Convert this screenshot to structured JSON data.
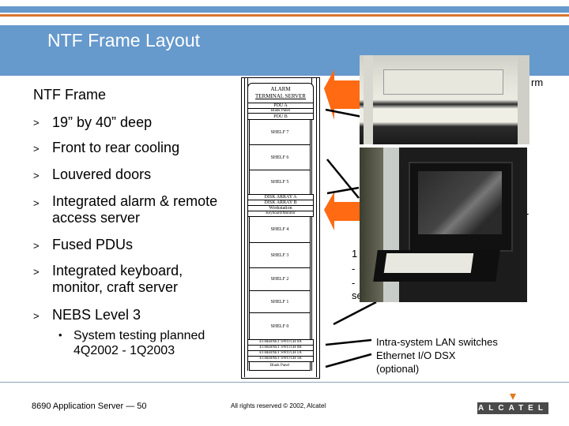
{
  "header": {
    "title": "NTF Frame Layout"
  },
  "left": {
    "heading": "NTF Frame",
    "bullets": [
      {
        "marker": ">",
        "text": "19” by 40” deep"
      },
      {
        "marker": ">",
        "text": "Front to rear cooling"
      },
      {
        "marker": ">",
        "text": "Louvered doors"
      },
      {
        "marker": ">",
        "text": "Integrated alarm & remote access server"
      },
      {
        "marker": ">",
        "text": "Fused PDUs"
      },
      {
        "marker": ">",
        "text": "Integrated keyboard, monitor, craft server"
      },
      {
        "marker": ">",
        "text": "NEBS Level 3"
      }
    ],
    "sub_bullet": {
      "marker": "•",
      "text": "System testing planned 4Q2002 - 1Q2003"
    }
  },
  "rack": {
    "alarm_line1": "ALARM",
    "alarm_line2": "TERMINAL SERVER",
    "pdu_a": "PDU A",
    "blank_panel_top": "Blank Panel",
    "pdu_b": "PDU B",
    "shelf7": "SHELF 7",
    "shelf6": "SHELF 6",
    "shelf5": "SHELF 5",
    "disk_a": "DISK ARRAY A",
    "disk_b": "DISK ARRAY B",
    "workstation": "Workstation",
    "kbd_monitor": "Keyboard/Monitor",
    "shelf4": "SHELF 4",
    "shelf3": "SHELF 3",
    "shelf2": "SHELF 2",
    "shelf1": "SHELF 1",
    "shelf0": "SHELF 0",
    "sw0a": "ETHERNET SWITCH 0A",
    "sw0b": "ETHERNET SWITCH 0B",
    "sw1a": "ETHERNET SWITCH 1A",
    "sw1b": "ETHERNET SWITCH 1B",
    "blank_panel_bottom": "Blank Panel"
  },
  "right": {
    "partial_rm": "rm",
    "partial_dash1": "-",
    "partial_1": "1",
    "partial_dash2": "-",
    "partial_dash3": "-",
    "partial_se": "se",
    "lan_switches": "Intra-system LAN switches",
    "ethernet_dsx": "Ethernet I/O DSX",
    "optional": "(optional)"
  },
  "footer": {
    "left": "8690 Application Server — 50",
    "center": "All rights reserved © 2002, Alcatel",
    "logo": "ALCATEL"
  },
  "colors": {
    "header_blue": "#6699cc",
    "accent_orange": "#d9762e",
    "arrow_orange": "#ff6a13",
    "logo_bg": "#4a4a4a"
  }
}
